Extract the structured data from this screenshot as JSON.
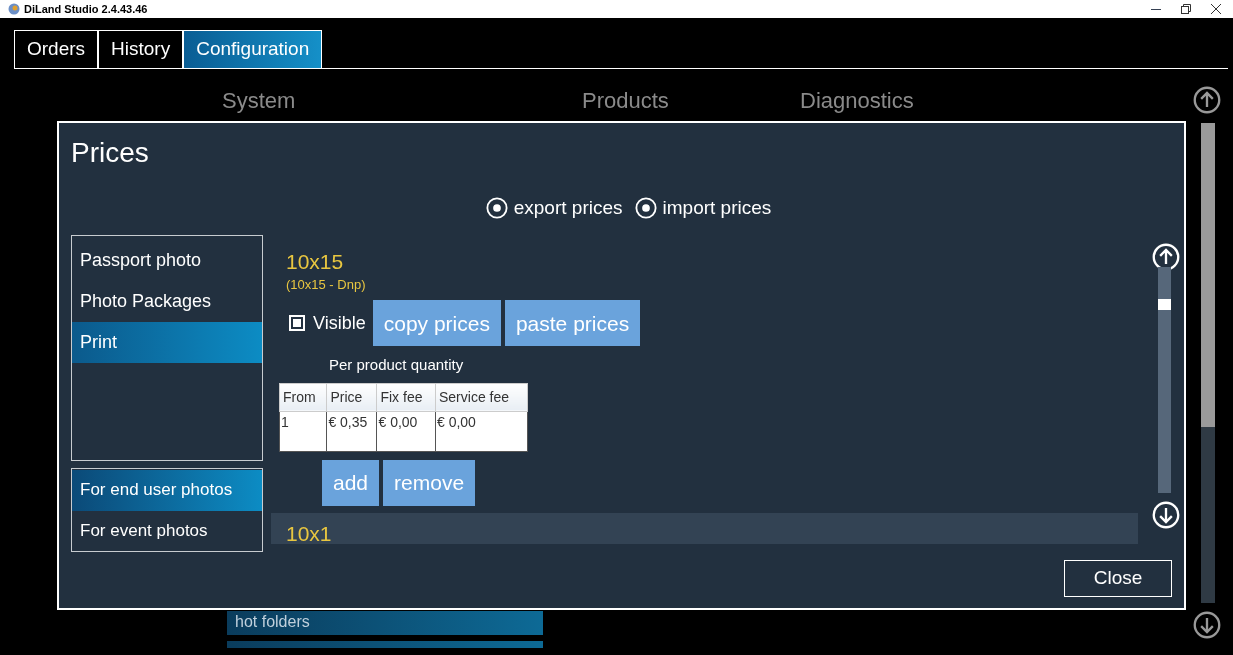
{
  "window": {
    "title": "DiLand Studio 2.4.43.46"
  },
  "tabs": [
    {
      "label": "Orders",
      "selected": false
    },
    {
      "label": "History",
      "selected": false
    },
    {
      "label": "Configuration",
      "selected": true
    }
  ],
  "sections": [
    "System",
    "Products",
    "Diagnostics"
  ],
  "background_item": "hot folders",
  "dialog": {
    "title": "Prices",
    "actions": [
      "export prices",
      "import prices"
    ],
    "categories": [
      {
        "label": "Passport photo",
        "selected": false
      },
      {
        "label": "Photo Packages",
        "selected": false
      },
      {
        "label": "Print",
        "selected": true
      }
    ],
    "photo_types": [
      {
        "label": "For end user photos",
        "selected": true
      },
      {
        "label": "For event photos",
        "selected": false
      }
    ],
    "product": {
      "name": "10x15",
      "subtitle": "(10x15 - Dnp)",
      "visible": {
        "label": "Visible",
        "checked": true
      },
      "buttons": [
        "copy prices",
        "paste prices"
      ],
      "table_caption": "Per product quantity",
      "columns": [
        "From",
        "Price",
        "Fix fee",
        "Service fee"
      ],
      "rows": [
        [
          "1",
          "€ 0,35",
          "€ 0,00",
          "€ 0,00"
        ]
      ],
      "row_buttons": [
        "add",
        "remove"
      ]
    },
    "next_product": "10x1",
    "close": "Close"
  }
}
